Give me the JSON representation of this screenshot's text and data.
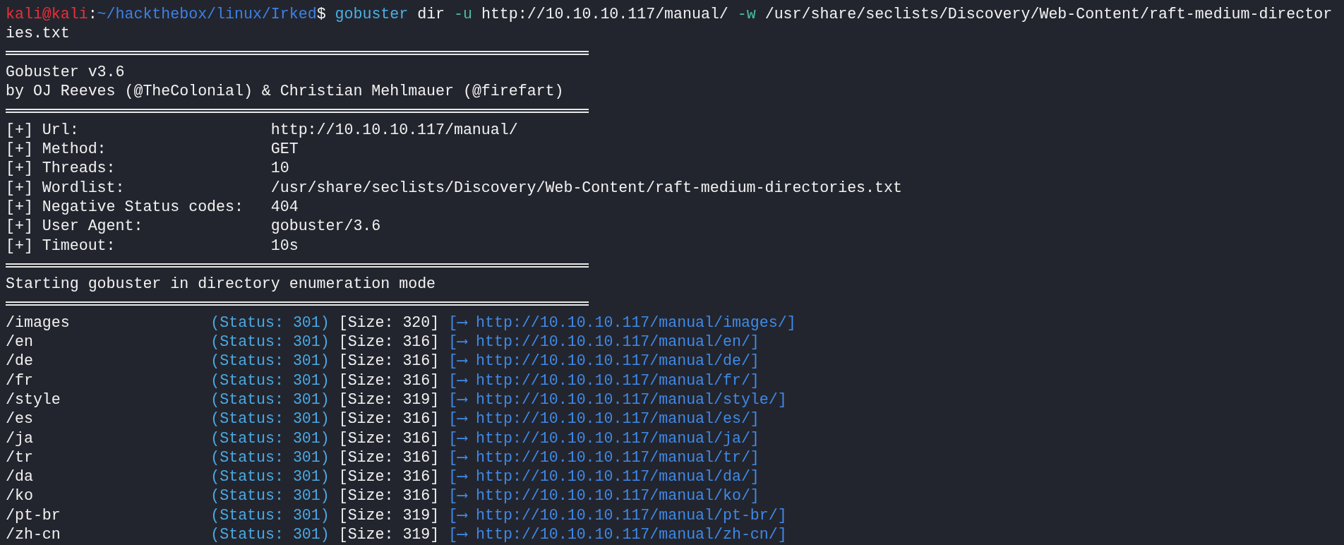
{
  "prompt": {
    "user_host": "kali@kali",
    "colon": ":",
    "path": "~/hackthebox/linux/Irked",
    "symbol": "$"
  },
  "command": [
    {
      "text": "gobuster",
      "kind": "program"
    },
    {
      "text": "dir",
      "kind": "arg"
    },
    {
      "text": "-u",
      "kind": "flag"
    },
    {
      "text": "http://10.10.10.117/manual/",
      "kind": "arg"
    },
    {
      "text": "-w",
      "kind": "flag"
    },
    {
      "text": "/usr/share/seclists/Discovery/Web-Content/raft-medium-director",
      "kind": "arg"
    }
  ],
  "command_wrap": "ies.txt",
  "banner": {
    "title": "Gobuster v3.6",
    "authors": "by OJ Reeves (@TheColonial) & Christian Mehlmauer (@firefart)"
  },
  "settings": [
    {
      "label": "[+] Url:",
      "value": "http://10.10.10.117/manual/"
    },
    {
      "label": "[+] Method:",
      "value": "GET"
    },
    {
      "label": "[+] Threads:",
      "value": "10"
    },
    {
      "label": "[+] Wordlist:",
      "value": "/usr/share/seclists/Discovery/Web-Content/raft-medium-directories.txt"
    },
    {
      "label": "[+] Negative Status codes:",
      "value": "404"
    },
    {
      "label": "[+] User Agent:",
      "value": "gobuster/3.6"
    },
    {
      "label": "[+] Timeout:",
      "value": "10s"
    }
  ],
  "status_message": "Starting gobuster in directory enumeration mode",
  "results": [
    {
      "path": "/images",
      "status": "(Status: 301)",
      "size": "[Size: 320]",
      "redirect": "[⟶ http://10.10.10.117/manual/images/]"
    },
    {
      "path": "/en",
      "status": "(Status: 301)",
      "size": "[Size: 316]",
      "redirect": "[⟶ http://10.10.10.117/manual/en/]"
    },
    {
      "path": "/de",
      "status": "(Status: 301)",
      "size": "[Size: 316]",
      "redirect": "[⟶ http://10.10.10.117/manual/de/]"
    },
    {
      "path": "/fr",
      "status": "(Status: 301)",
      "size": "[Size: 316]",
      "redirect": "[⟶ http://10.10.10.117/manual/fr/]"
    },
    {
      "path": "/style",
      "status": "(Status: 301)",
      "size": "[Size: 319]",
      "redirect": "[⟶ http://10.10.10.117/manual/style/]"
    },
    {
      "path": "/es",
      "status": "(Status: 301)",
      "size": "[Size: 316]",
      "redirect": "[⟶ http://10.10.10.117/manual/es/]"
    },
    {
      "path": "/ja",
      "status": "(Status: 301)",
      "size": "[Size: 316]",
      "redirect": "[⟶ http://10.10.10.117/manual/ja/]"
    },
    {
      "path": "/tr",
      "status": "(Status: 301)",
      "size": "[Size: 316]",
      "redirect": "[⟶ http://10.10.10.117/manual/tr/]"
    },
    {
      "path": "/da",
      "status": "(Status: 301)",
      "size": "[Size: 316]",
      "redirect": "[⟶ http://10.10.10.117/manual/da/]"
    },
    {
      "path": "/ko",
      "status": "(Status: 301)",
      "size": "[Size: 316]",
      "redirect": "[⟶ http://10.10.10.117/manual/ko/]"
    },
    {
      "path": "/pt-br",
      "status": "(Status: 301)",
      "size": "[Size: 319]",
      "redirect": "[⟶ http://10.10.10.117/manual/pt-br/]"
    },
    {
      "path": "/zh-cn",
      "status": "(Status: 301)",
      "size": "[Size: 319]",
      "redirect": "[⟶ http://10.10.10.117/manual/zh-cn/]"
    }
  ]
}
